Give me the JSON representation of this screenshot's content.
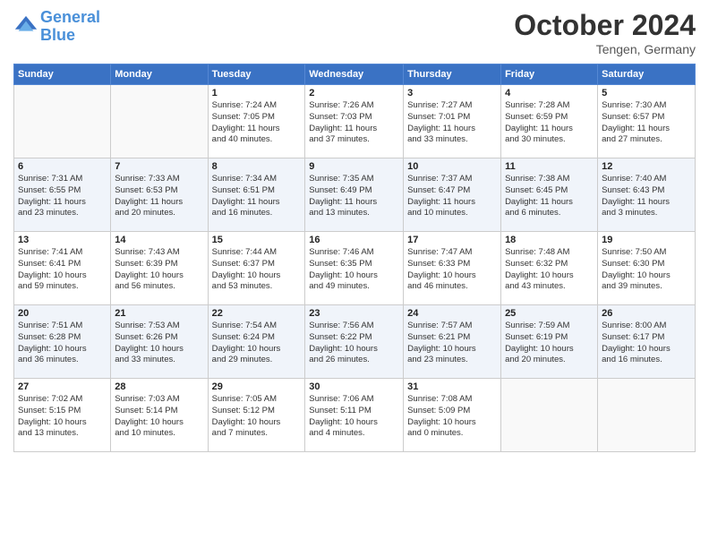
{
  "logo": {
    "line1": "General",
    "line2": "Blue"
  },
  "title": "October 2024",
  "subtitle": "Tengen, Germany",
  "days_header": [
    "Sunday",
    "Monday",
    "Tuesday",
    "Wednesday",
    "Thursday",
    "Friday",
    "Saturday"
  ],
  "weeks": [
    [
      {
        "day": "",
        "info": ""
      },
      {
        "day": "",
        "info": ""
      },
      {
        "day": "1",
        "info": "Sunrise: 7:24 AM\nSunset: 7:05 PM\nDaylight: 11 hours\nand 40 minutes."
      },
      {
        "day": "2",
        "info": "Sunrise: 7:26 AM\nSunset: 7:03 PM\nDaylight: 11 hours\nand 37 minutes."
      },
      {
        "day": "3",
        "info": "Sunrise: 7:27 AM\nSunset: 7:01 PM\nDaylight: 11 hours\nand 33 minutes."
      },
      {
        "day": "4",
        "info": "Sunrise: 7:28 AM\nSunset: 6:59 PM\nDaylight: 11 hours\nand 30 minutes."
      },
      {
        "day": "5",
        "info": "Sunrise: 7:30 AM\nSunset: 6:57 PM\nDaylight: 11 hours\nand 27 minutes."
      }
    ],
    [
      {
        "day": "6",
        "info": "Sunrise: 7:31 AM\nSunset: 6:55 PM\nDaylight: 11 hours\nand 23 minutes."
      },
      {
        "day": "7",
        "info": "Sunrise: 7:33 AM\nSunset: 6:53 PM\nDaylight: 11 hours\nand 20 minutes."
      },
      {
        "day": "8",
        "info": "Sunrise: 7:34 AM\nSunset: 6:51 PM\nDaylight: 11 hours\nand 16 minutes."
      },
      {
        "day": "9",
        "info": "Sunrise: 7:35 AM\nSunset: 6:49 PM\nDaylight: 11 hours\nand 13 minutes."
      },
      {
        "day": "10",
        "info": "Sunrise: 7:37 AM\nSunset: 6:47 PM\nDaylight: 11 hours\nand 10 minutes."
      },
      {
        "day": "11",
        "info": "Sunrise: 7:38 AM\nSunset: 6:45 PM\nDaylight: 11 hours\nand 6 minutes."
      },
      {
        "day": "12",
        "info": "Sunrise: 7:40 AM\nSunset: 6:43 PM\nDaylight: 11 hours\nand 3 minutes."
      }
    ],
    [
      {
        "day": "13",
        "info": "Sunrise: 7:41 AM\nSunset: 6:41 PM\nDaylight: 10 hours\nand 59 minutes."
      },
      {
        "day": "14",
        "info": "Sunrise: 7:43 AM\nSunset: 6:39 PM\nDaylight: 10 hours\nand 56 minutes."
      },
      {
        "day": "15",
        "info": "Sunrise: 7:44 AM\nSunset: 6:37 PM\nDaylight: 10 hours\nand 53 minutes."
      },
      {
        "day": "16",
        "info": "Sunrise: 7:46 AM\nSunset: 6:35 PM\nDaylight: 10 hours\nand 49 minutes."
      },
      {
        "day": "17",
        "info": "Sunrise: 7:47 AM\nSunset: 6:33 PM\nDaylight: 10 hours\nand 46 minutes."
      },
      {
        "day": "18",
        "info": "Sunrise: 7:48 AM\nSunset: 6:32 PM\nDaylight: 10 hours\nand 43 minutes."
      },
      {
        "day": "19",
        "info": "Sunrise: 7:50 AM\nSunset: 6:30 PM\nDaylight: 10 hours\nand 39 minutes."
      }
    ],
    [
      {
        "day": "20",
        "info": "Sunrise: 7:51 AM\nSunset: 6:28 PM\nDaylight: 10 hours\nand 36 minutes."
      },
      {
        "day": "21",
        "info": "Sunrise: 7:53 AM\nSunset: 6:26 PM\nDaylight: 10 hours\nand 33 minutes."
      },
      {
        "day": "22",
        "info": "Sunrise: 7:54 AM\nSunset: 6:24 PM\nDaylight: 10 hours\nand 29 minutes."
      },
      {
        "day": "23",
        "info": "Sunrise: 7:56 AM\nSunset: 6:22 PM\nDaylight: 10 hours\nand 26 minutes."
      },
      {
        "day": "24",
        "info": "Sunrise: 7:57 AM\nSunset: 6:21 PM\nDaylight: 10 hours\nand 23 minutes."
      },
      {
        "day": "25",
        "info": "Sunrise: 7:59 AM\nSunset: 6:19 PM\nDaylight: 10 hours\nand 20 minutes."
      },
      {
        "day": "26",
        "info": "Sunrise: 8:00 AM\nSunset: 6:17 PM\nDaylight: 10 hours\nand 16 minutes."
      }
    ],
    [
      {
        "day": "27",
        "info": "Sunrise: 7:02 AM\nSunset: 5:15 PM\nDaylight: 10 hours\nand 13 minutes."
      },
      {
        "day": "28",
        "info": "Sunrise: 7:03 AM\nSunset: 5:14 PM\nDaylight: 10 hours\nand 10 minutes."
      },
      {
        "day": "29",
        "info": "Sunrise: 7:05 AM\nSunset: 5:12 PM\nDaylight: 10 hours\nand 7 minutes."
      },
      {
        "day": "30",
        "info": "Sunrise: 7:06 AM\nSunset: 5:11 PM\nDaylight: 10 hours\nand 4 minutes."
      },
      {
        "day": "31",
        "info": "Sunrise: 7:08 AM\nSunset: 5:09 PM\nDaylight: 10 hours\nand 0 minutes."
      },
      {
        "day": "",
        "info": ""
      },
      {
        "day": "",
        "info": ""
      }
    ]
  ]
}
